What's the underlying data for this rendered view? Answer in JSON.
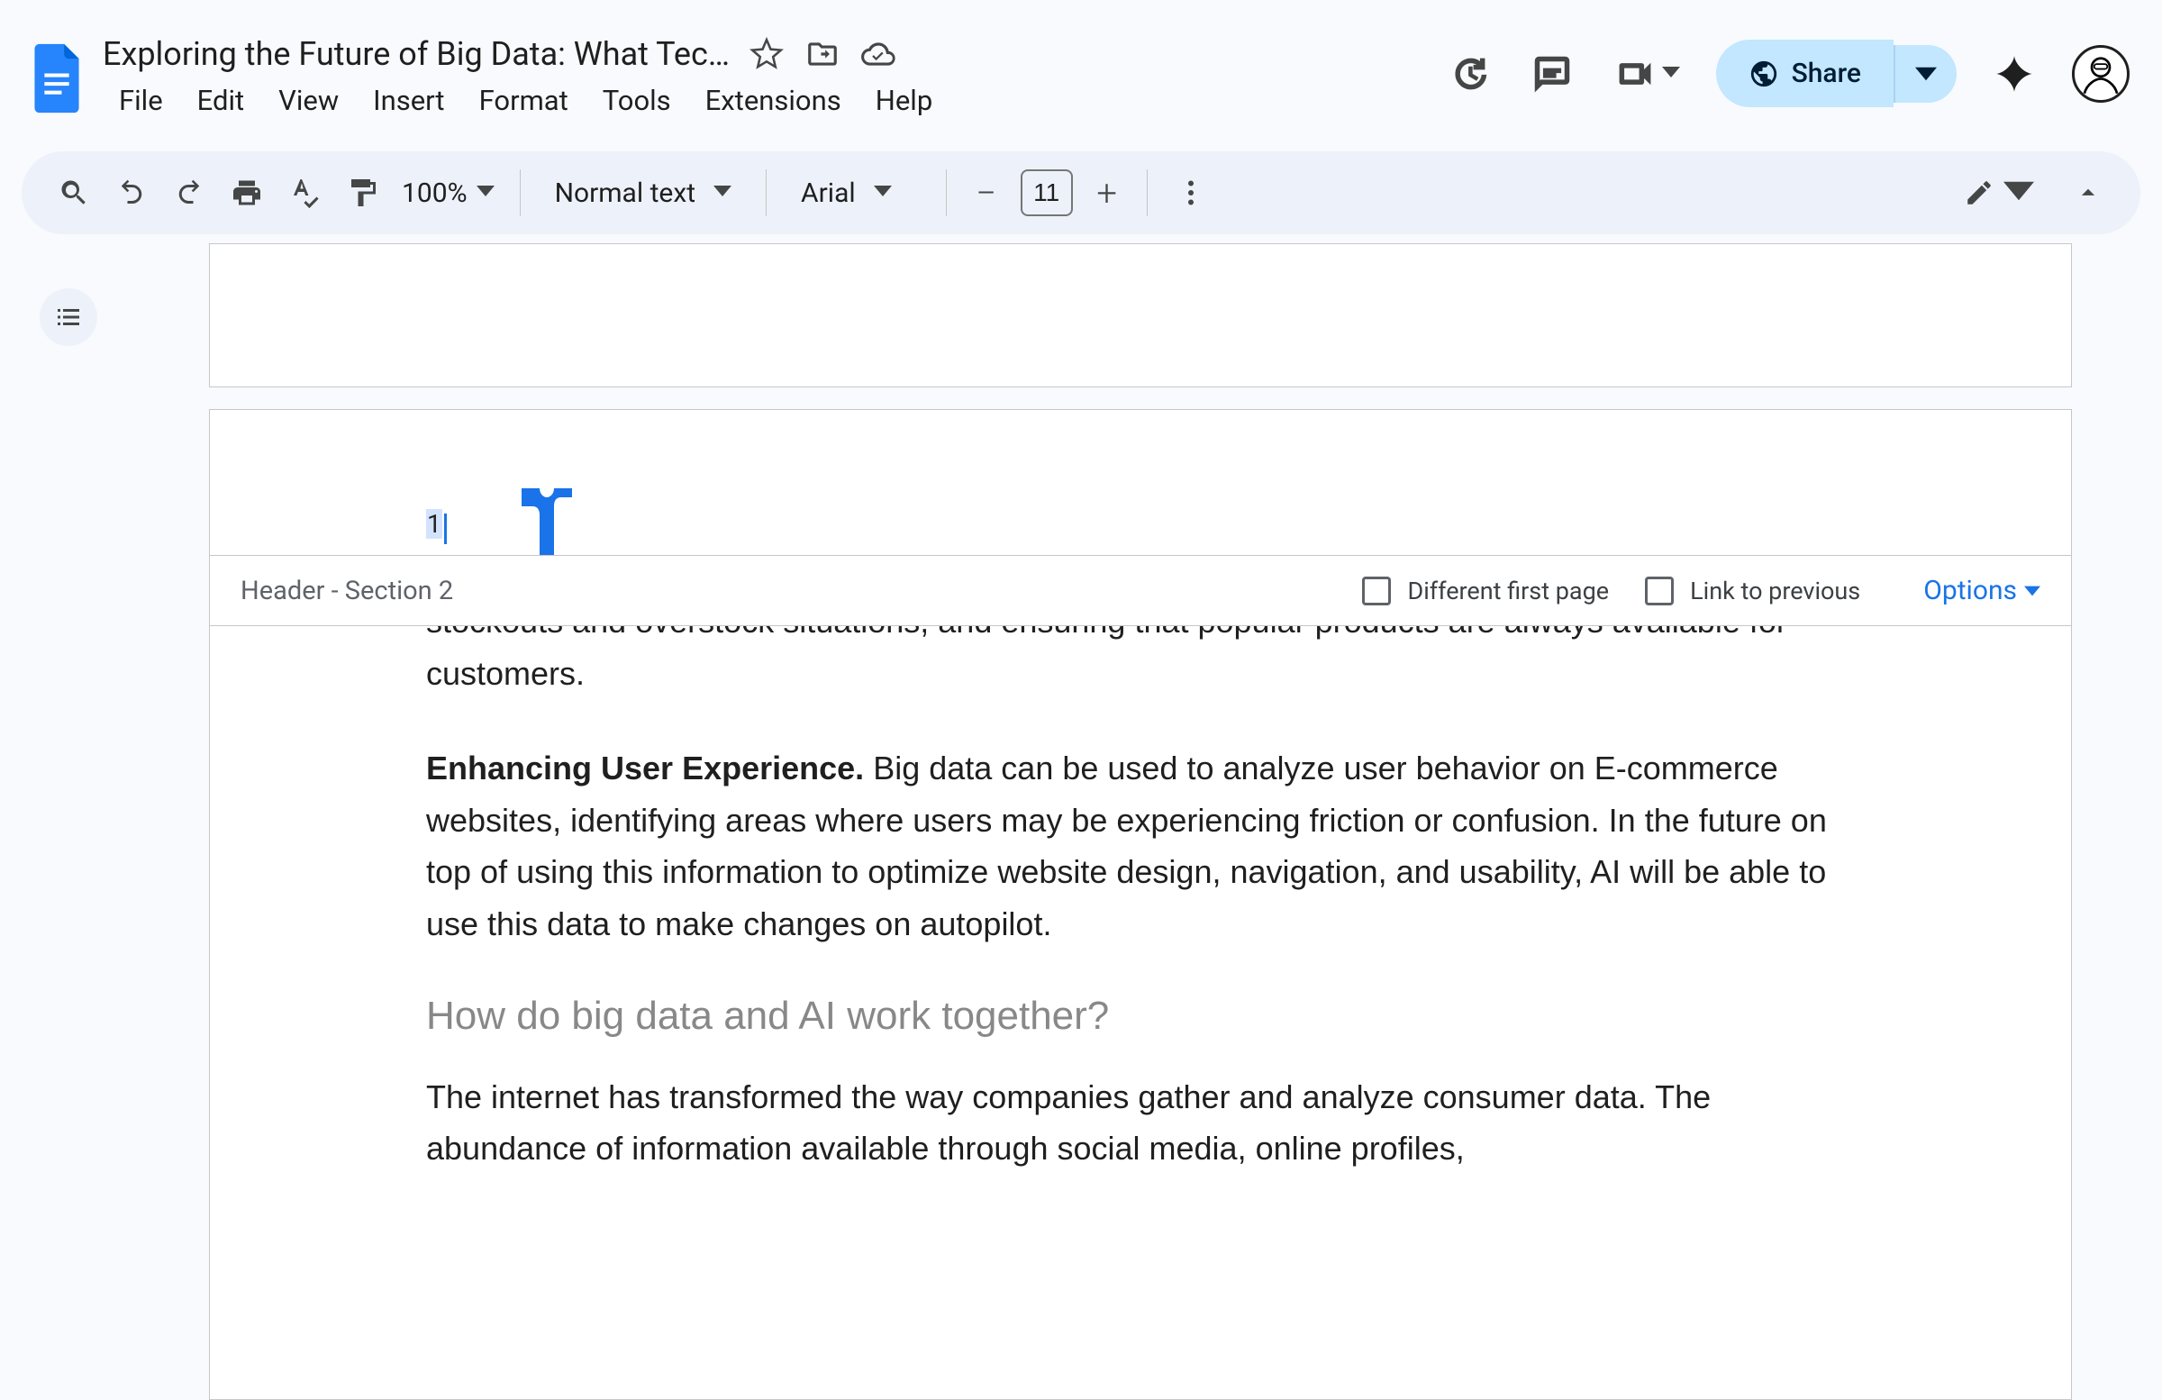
{
  "app": {
    "title": "Exploring the Future of Big Data: What Tec…"
  },
  "menubar": {
    "items": [
      "File",
      "Edit",
      "View",
      "Insert",
      "Format",
      "Tools",
      "Extensions",
      "Help"
    ]
  },
  "actions": {
    "share_label": "Share"
  },
  "toolbar": {
    "zoom": "100%",
    "style": "Normal text",
    "font": "Arial",
    "font_size": "11"
  },
  "header": {
    "page_number": "1",
    "section_label": "Header - Section 2",
    "different_first_page_label": "Different first page",
    "link_to_previous_label": "Link to previous",
    "options_label": "Options"
  },
  "doc": {
    "p1": "stockouts and overstock situations, and ensuring that popular products are always available for customers.",
    "p2_bold": "Enhancing User Experience.",
    "p2_rest": " Big data can be used to analyze user behavior on E-commerce websites, identifying areas where users may be experiencing friction or confusion. In the future on top of using this information to optimize website design, navigation, and usability, AI will be able to use this data to make changes on autopilot.",
    "h2": "How do big data and AI work together?",
    "p3": "The internet has transformed the way companies gather and analyze consumer data. The abundance of information available through social media, online profiles,"
  }
}
